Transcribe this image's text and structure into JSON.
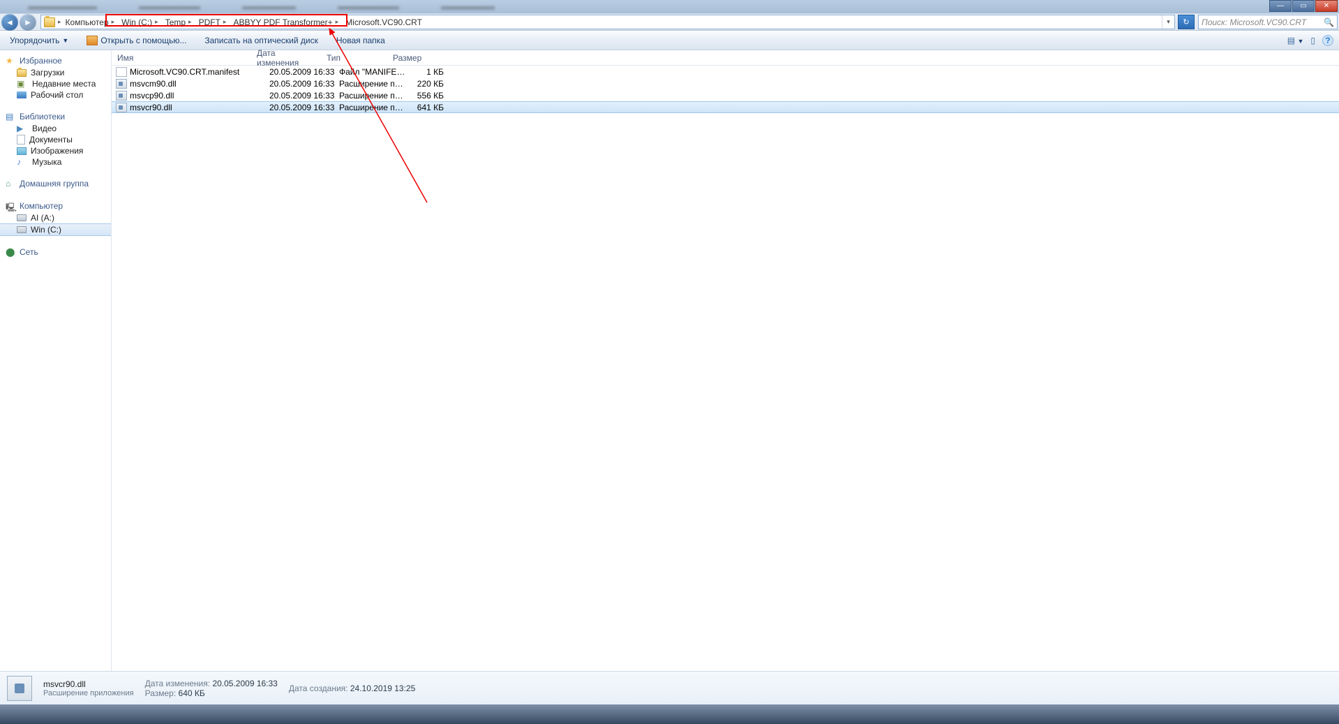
{
  "titlebar": {
    "tabs_blur": [
      "",
      "",
      "",
      ""
    ]
  },
  "breadcrumbs": {
    "items": [
      "Компьютер",
      "Win (C:)",
      "Temp",
      "PDFT",
      "ABBYY PDF Transformer+",
      "Microsoft.VC90.CRT"
    ]
  },
  "search": {
    "placeholder": "Поиск: Microsoft.VC90.CRT"
  },
  "toolbar": {
    "organize": "Упорядочить",
    "openwith": "Открыть с помощью...",
    "burn": "Записать на оптический диск",
    "newfolder": "Новая папка"
  },
  "sidebar": {
    "favorites": {
      "header": "Избранное",
      "items": [
        "Загрузки",
        "Недавние места",
        "Рабочий стол"
      ]
    },
    "libraries": {
      "header": "Библиотеки",
      "items": [
        "Видео",
        "Документы",
        "Изображения",
        "Музыка"
      ]
    },
    "homegroup": {
      "header": "Домашняя группа"
    },
    "computer": {
      "header": "Компьютер",
      "items": [
        "AI (A:)",
        "Win (C:)"
      ],
      "selected": 1
    },
    "network": {
      "header": "Сеть"
    }
  },
  "columns": {
    "name": "Имя",
    "date": "Дата изменения",
    "type": "Тип",
    "size": "Размер"
  },
  "files": [
    {
      "name": "Microsoft.VC90.CRT.manifest",
      "date": "20.05.2009 16:33",
      "type": "Файл \"MANIFEST\"",
      "size": "1 КБ",
      "icon": "manifest"
    },
    {
      "name": "msvcm90.dll",
      "date": "20.05.2009 16:33",
      "type": "Расширение при...",
      "size": "220 КБ",
      "icon": "dll"
    },
    {
      "name": "msvcp90.dll",
      "date": "20.05.2009 16:33",
      "type": "Расширение при...",
      "size": "556 КБ",
      "icon": "dll"
    },
    {
      "name": "msvcr90.dll",
      "date": "20.05.2009 16:33",
      "type": "Расширение при...",
      "size": "641 КБ",
      "icon": "dll"
    }
  ],
  "selected_file_index": 3,
  "details": {
    "name": "msvcr90.dll",
    "type": "Расширение приложения",
    "date_mod_label": "Дата изменения:",
    "date_mod": "20.05.2009 16:33",
    "size_label": "Размер:",
    "size": "640 КБ",
    "date_created_label": "Дата создания:",
    "date_created": "24.10.2019 13:25"
  }
}
